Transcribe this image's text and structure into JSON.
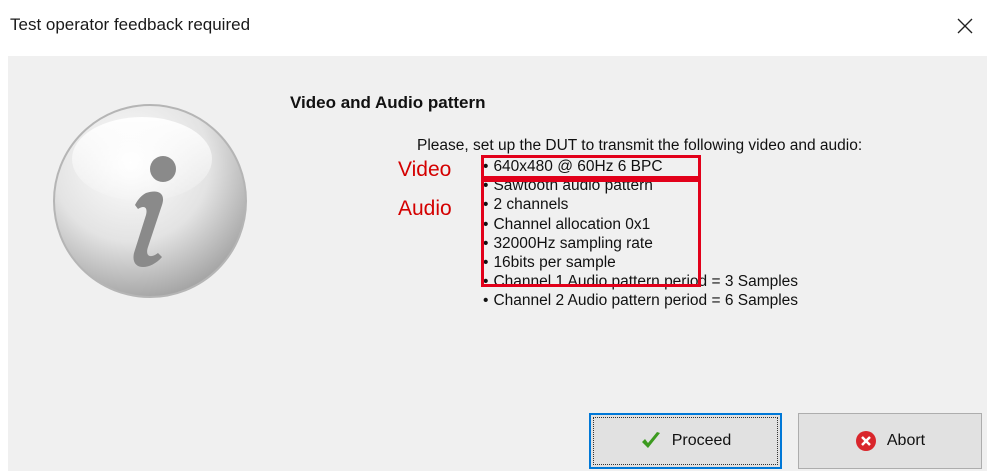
{
  "window": {
    "title": "Test operator feedback required",
    "close_icon": "close-icon"
  },
  "dialog": {
    "icon": "info-icon",
    "heading": "Video and Audio pattern",
    "intro": "Please, set up the DUT to transmit the following video and audio:",
    "bullets": [
      "640x480 @ 60Hz 6 BPC",
      "Sawtooth audio pattern",
      "2 channels",
      "Channel allocation 0x1",
      "32000Hz sampling rate",
      "16bits per sample",
      "Channel 1 Audio pattern period = 3 Samples",
      "Channel 2 Audio pattern period = 6 Samples"
    ],
    "annotations": {
      "video": "Video",
      "audio": "Audio",
      "color": "#e2001a"
    }
  },
  "buttons": {
    "proceed": {
      "label": "Proceed",
      "icon": "checkmark-icon"
    },
    "abort": {
      "label": "Abort",
      "icon": "abort-icon"
    }
  },
  "colors": {
    "client_bg": "#f0f0f0",
    "focus_border": "#0078d7",
    "abort_red": "#d9262c",
    "check_green": "#3c9a1f"
  }
}
